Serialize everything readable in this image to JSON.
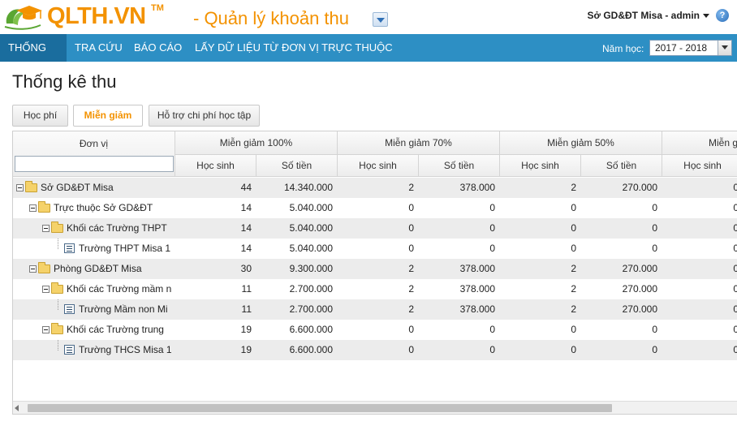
{
  "header": {
    "logo_text": "QLTH.VN",
    "logo_tm": "TM",
    "app_title": "- Quản lý khoản thu",
    "user": "Sở GD&ĐT Misa - admin",
    "help_symbol": "?"
  },
  "nav": {
    "items": [
      "THỐNG KÊ",
      "TRA CỨU",
      "BÁO CÁO",
      "LẤY DỮ LIỆU TỪ ĐƠN VỊ TRỰC THUỘC"
    ],
    "active_index": 0,
    "year_label": "Năm học:",
    "year_value": "2017 - 2018"
  },
  "page": {
    "title": "Thống kê thu"
  },
  "tabs": [
    {
      "label": "Học phí",
      "active": false
    },
    {
      "label": "Miễn giảm",
      "active": true
    },
    {
      "label": "Hỗ trợ chi phí học tập",
      "active": false
    }
  ],
  "grid": {
    "columns": {
      "unit": "Đơn vị",
      "groups": [
        "Miễn giảm 100%",
        "Miễn giảm 70%",
        "Miễn giảm 50%",
        "Miễn g"
      ],
      "sub_students": "Học sinh",
      "sub_amount": "Số tiền"
    },
    "rows": [
      {
        "name": "Sở GD&ĐT Misa",
        "level": 0,
        "kind": "folder",
        "values": [
          "44",
          "14.340.000",
          "2",
          "378.000",
          "2",
          "270.000",
          "0"
        ]
      },
      {
        "name": "Trực thuộc Sở GD&ĐT",
        "level": 1,
        "kind": "folder",
        "values": [
          "14",
          "5.040.000",
          "0",
          "0",
          "0",
          "0",
          "0"
        ]
      },
      {
        "name": "Khối các Trường THPT",
        "level": 2,
        "kind": "folder",
        "values": [
          "14",
          "5.040.000",
          "0",
          "0",
          "0",
          "0",
          "0"
        ]
      },
      {
        "name": "Trường THPT Misa 1",
        "level": 3,
        "kind": "doc",
        "values": [
          "14",
          "5.040.000",
          "0",
          "0",
          "0",
          "0",
          "0"
        ]
      },
      {
        "name": "Phòng GD&ĐT Misa",
        "level": 1,
        "kind": "folder",
        "values": [
          "30",
          "9.300.000",
          "2",
          "378.000",
          "2",
          "270.000",
          "0"
        ]
      },
      {
        "name": "Khối các Trường mầm n",
        "level": 2,
        "kind": "folder",
        "values": [
          "11",
          "2.700.000",
          "2",
          "378.000",
          "2",
          "270.000",
          "0"
        ]
      },
      {
        "name": "Trường Mầm non Mi",
        "level": 3,
        "kind": "doc",
        "values": [
          "11",
          "2.700.000",
          "2",
          "378.000",
          "2",
          "270.000",
          "0"
        ]
      },
      {
        "name": "Khối các Trường trung",
        "level": 2,
        "kind": "folder",
        "values": [
          "19",
          "6.600.000",
          "0",
          "0",
          "0",
          "0",
          "0"
        ]
      },
      {
        "name": "Trường THCS Misa 1",
        "level": 3,
        "kind": "doc",
        "values": [
          "19",
          "6.600.000",
          "0",
          "0",
          "0",
          "0",
          "0"
        ]
      }
    ]
  },
  "colors": {
    "brand": "#f39200",
    "nav": "#2d8fc4",
    "nav_active": "#1a6d9e",
    "row_alt": "#ececec"
  }
}
